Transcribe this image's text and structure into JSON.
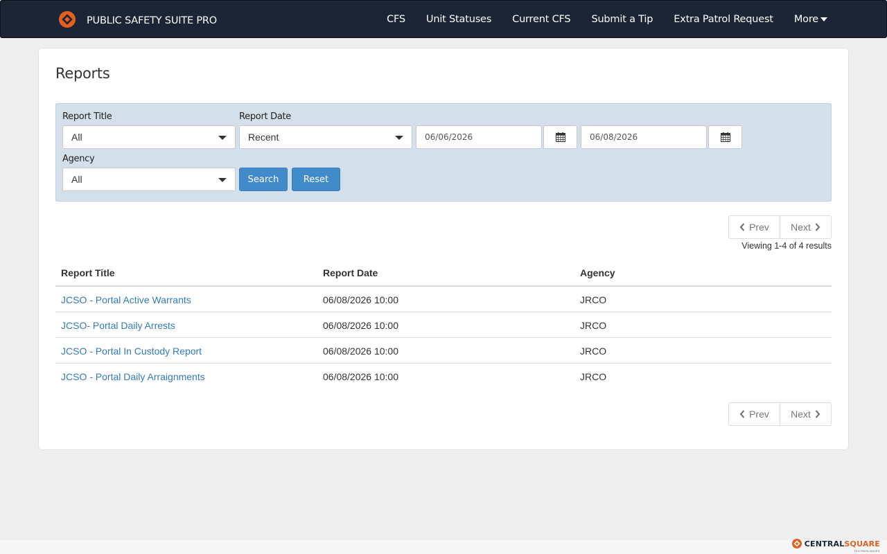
{
  "navbar": {
    "brand_name": "PUBLIC SAFETY SUITE PRO",
    "logo_icon": "centralsquare-logo-icon",
    "links": [
      "CFS",
      "Unit Statuses",
      "Current CFS",
      "Submit a Tip",
      "Extra Patrol Request"
    ],
    "more_label": "More"
  },
  "page": {
    "title": "Reports"
  },
  "filters": {
    "report_title_label": "Report Title",
    "report_title_value": "All",
    "report_date_label": "Report Date",
    "report_date_value": "Recent",
    "date_from": "06/06/2026",
    "date_to": "06/08/2026",
    "agency_label": "Agency",
    "agency_value": "All",
    "search_label": "Search",
    "reset_label": "Reset"
  },
  "pagination": {
    "prev_label": "Prev",
    "next_label": "Next",
    "viewing_text": "Viewing 1-4 of 4 results"
  },
  "table": {
    "headers": [
      "Report Title",
      "Report Date",
      "Agency"
    ],
    "rows": [
      {
        "title": "JCSO - Portal Active Warrants",
        "date": "06/08/2026 10:00",
        "agency": "JRCO"
      },
      {
        "title": "JCSO- Portal Daily Arrests",
        "date": "06/08/2026 10:00",
        "agency": "JRCO"
      },
      {
        "title": "JCSO - Portal In Custody Report",
        "date": "06/08/2026 10:00",
        "agency": "JRCO"
      },
      {
        "title": "JCSO - Portal Daily Arraignments",
        "date": "06/08/2026 10:00",
        "agency": "JRCO"
      }
    ]
  },
  "footer": {
    "logo_part1": "CENTRAL",
    "logo_part2": "SQUARE",
    "logo_sub": "TECHNOLOGIES"
  },
  "colors": {
    "navbar_bg": "#1b2535",
    "accent_orange": "#e35f1f",
    "primary_blue": "#428bca",
    "link_blue": "#337ab7",
    "filter_bg": "#d3dfeb"
  }
}
